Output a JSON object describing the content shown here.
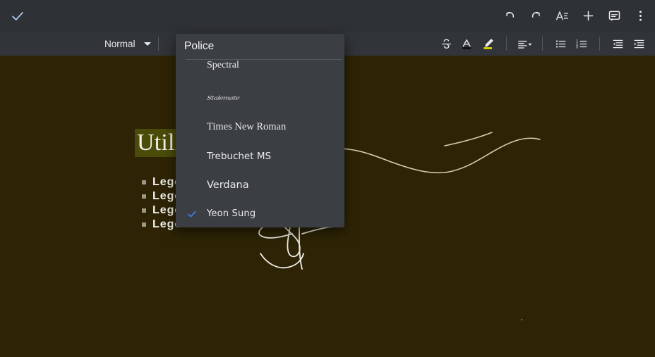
{
  "app": {
    "topbar": {
      "accept_icon": "check-icon",
      "actions": [
        {
          "name": "undo-button",
          "icon": "undo-icon",
          "label": "Undo"
        },
        {
          "name": "redo-button",
          "icon": "redo-icon",
          "label": "Redo"
        },
        {
          "name": "text-format-button",
          "icon": "text-format-icon",
          "label": "Text formatting"
        },
        {
          "name": "insert-button",
          "icon": "plus-icon",
          "label": "Insert"
        },
        {
          "name": "comment-button",
          "icon": "comment-icon",
          "label": "Comment"
        },
        {
          "name": "more-options-button",
          "icon": "more-vertical-icon",
          "label": "More options"
        }
      ]
    },
    "toolbar": {
      "paragraph_style": "Normal",
      "buttons": [
        {
          "name": "strikethrough-button",
          "icon": "strikethrough-icon",
          "label": "Strikethrough"
        },
        {
          "name": "text-color-button",
          "icon": "text-color-icon",
          "label": "Text color",
          "swatch": "#0d0d0d"
        },
        {
          "name": "highlight-color-button",
          "icon": "highlight-pen-icon",
          "label": "Highlight color",
          "swatch": "#f2e100"
        },
        {
          "name": "align-button",
          "icon": "align-left-icon",
          "label": "Alignment"
        },
        {
          "name": "bulleted-list-button",
          "icon": "bulleted-list-icon",
          "label": "Bulleted list"
        },
        {
          "name": "numbered-list-button",
          "icon": "numbered-list-icon",
          "label": "Numbered list"
        },
        {
          "name": "decrease-indent-button",
          "icon": "decrease-indent-icon",
          "label": "Decrease indent"
        },
        {
          "name": "increase-indent-button",
          "icon": "increase-indent-icon",
          "label": "Increase indent"
        }
      ]
    },
    "font_menu": {
      "title": "Police",
      "items": [
        {
          "label": "Spectral",
          "style": "f-spectral",
          "checked": false
        },
        {
          "label": "Stalemate",
          "style": "f-stalemate",
          "checked": false
        },
        {
          "label": "Times New Roman",
          "style": "f-times",
          "checked": false
        },
        {
          "label": "Trebuchet MS",
          "style": "f-trebuchet",
          "checked": false
        },
        {
          "label": "Verdana",
          "style": "f-verdana",
          "checked": false
        },
        {
          "label": "Yeon Sung",
          "style": "f-yeonsung",
          "checked": true
        }
      ]
    },
    "document": {
      "title": "Utiliser les tableaux",
      "bullets": [
        "Legende",
        "Legende",
        "Legende",
        "Legende"
      ],
      "has_ink_annotation": true
    },
    "colors": {
      "topbar_bg": "#2e3136",
      "toolbar_bg": "#313438",
      "menu_bg": "#3b3e43",
      "document_bg": "#2e2405",
      "title_highlight": "#4b4b0a",
      "accent_check": "#8ab4f8",
      "menu_check": "#4285f4",
      "ink_stroke": "#d8cbb0"
    }
  }
}
